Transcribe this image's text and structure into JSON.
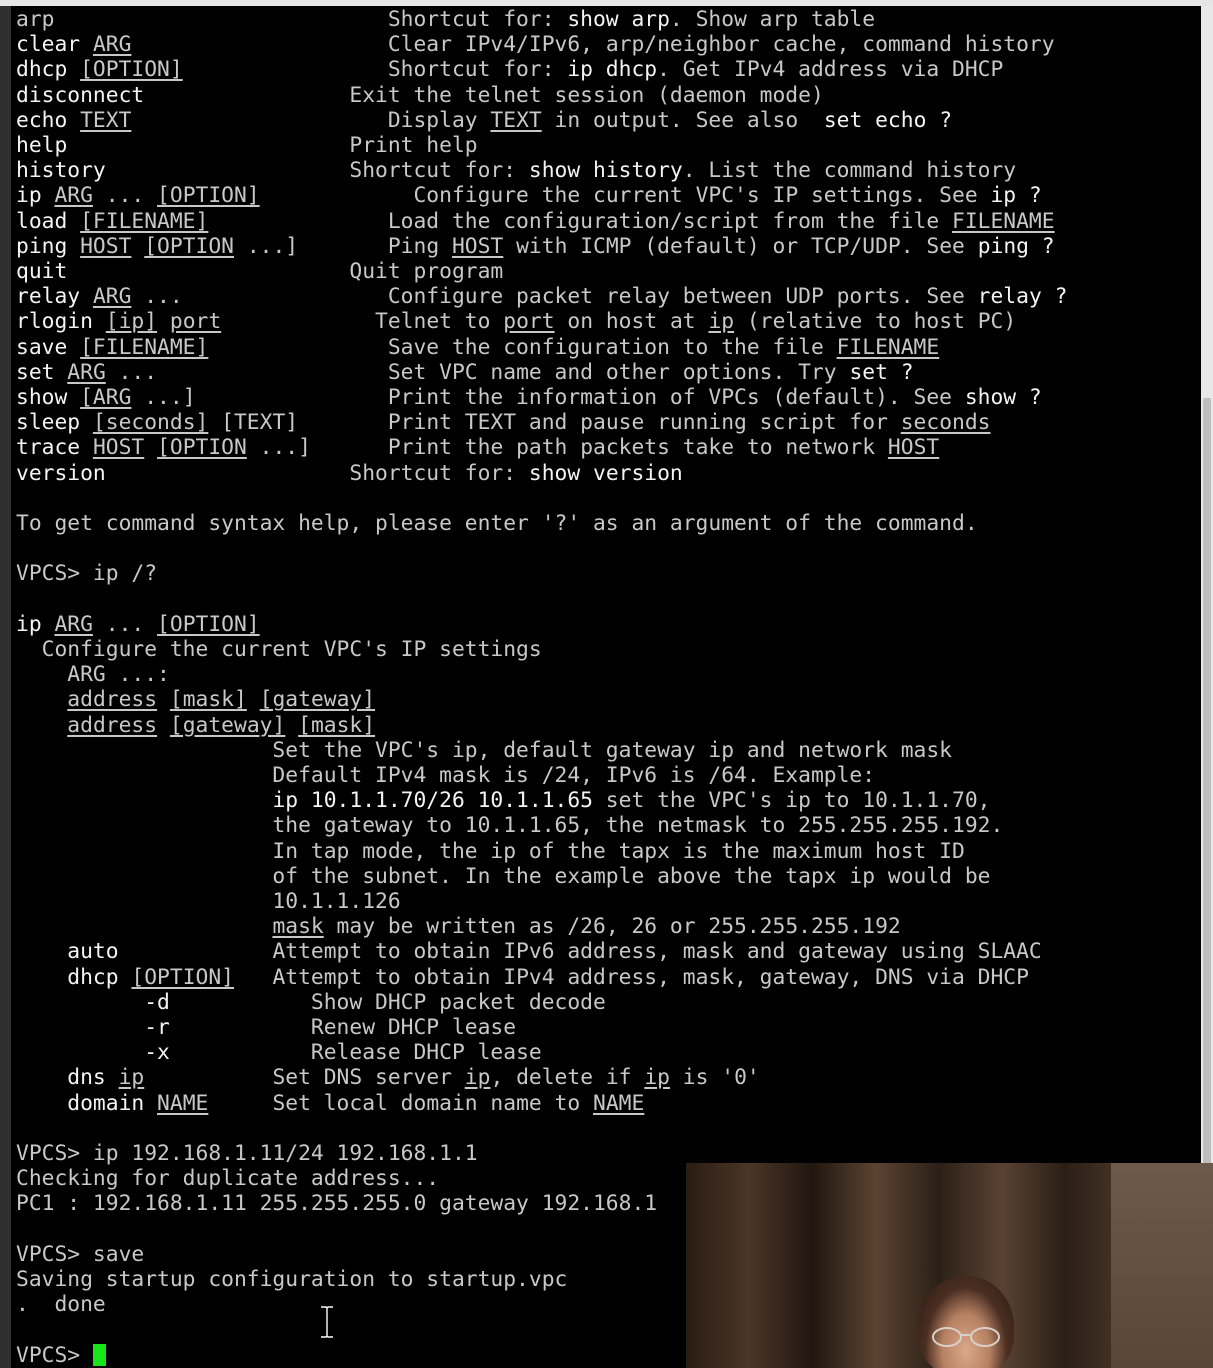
{
  "terminal": {
    "lines": [
      [
        {
          "t": "arp                          Shortcut for: "
        },
        {
          "t": "show arp",
          "c": "b"
        },
        {
          "t": ". Show arp table"
        }
      ],
      [
        {
          "t": "clear ",
          "c": "b"
        },
        {
          "t": "ARG",
          "c": "u"
        },
        {
          "t": "                    Clear IPv4/IPv6, arp/neighbor cache, command history"
        }
      ],
      [
        {
          "t": "dhcp ",
          "c": "b"
        },
        {
          "t": "[OPTION]",
          "c": "u"
        },
        {
          "t": "                Shortcut for: "
        },
        {
          "t": "ip dhcp",
          "c": "b"
        },
        {
          "t": ". Get IPv4 address via DHCP"
        }
      ],
      [
        {
          "t": "disconnect",
          "c": "b"
        },
        {
          "t": "                Exit the telnet session (daemon mode)"
        }
      ],
      [
        {
          "t": "echo ",
          "c": "b"
        },
        {
          "t": "TEXT",
          "c": "u"
        },
        {
          "t": "                    Display "
        },
        {
          "t": "TEXT",
          "c": "u"
        },
        {
          "t": " in output. See also  "
        },
        {
          "t": "set echo ?",
          "c": "b"
        }
      ],
      [
        {
          "t": "help",
          "c": "b"
        },
        {
          "t": "                      Print help"
        }
      ],
      [
        {
          "t": "history",
          "c": "b"
        },
        {
          "t": "                   Shortcut for: "
        },
        {
          "t": "show history",
          "c": "b"
        },
        {
          "t": ". List the command history"
        }
      ],
      [
        {
          "t": "ip ",
          "c": "b"
        },
        {
          "t": "ARG",
          "c": "u"
        },
        {
          "t": " ... "
        },
        {
          "t": "[OPTION]",
          "c": "u"
        },
        {
          "t": "            Configure the current VPC's IP settings. See "
        },
        {
          "t": "ip ?",
          "c": "b"
        }
      ],
      [
        {
          "t": "load ",
          "c": "b"
        },
        {
          "t": "[FILENAME]",
          "c": "u"
        },
        {
          "t": "              Load the configuration/script from the file "
        },
        {
          "t": "FILENAME",
          "c": "u"
        }
      ],
      [
        {
          "t": "ping ",
          "c": "b"
        },
        {
          "t": "HOST",
          "c": "u"
        },
        {
          "t": " "
        },
        {
          "t": "[OPTION",
          "c": "u"
        },
        {
          "t": " ...]       Ping "
        },
        {
          "t": "HOST",
          "c": "u"
        },
        {
          "t": " with ICMP (default) or TCP/UDP. See "
        },
        {
          "t": "ping ?",
          "c": "b"
        }
      ],
      [
        {
          "t": "quit",
          "c": "b"
        },
        {
          "t": "                      Quit program"
        }
      ],
      [
        {
          "t": "relay ",
          "c": "b"
        },
        {
          "t": "ARG",
          "c": "u"
        },
        {
          "t": " ...                Configure packet relay between UDP ports. See "
        },
        {
          "t": "relay ?",
          "c": "b"
        }
      ],
      [
        {
          "t": "rlogin ",
          "c": "b"
        },
        {
          "t": "[ip]",
          "c": "u"
        },
        {
          "t": " "
        },
        {
          "t": "port",
          "c": "u"
        },
        {
          "t": "            Telnet to "
        },
        {
          "t": "port",
          "c": "u"
        },
        {
          "t": " on host at "
        },
        {
          "t": "ip",
          "c": "u"
        },
        {
          "t": " (relative to host PC)"
        }
      ],
      [
        {
          "t": "save ",
          "c": "b"
        },
        {
          "t": "[FILENAME]",
          "c": "u"
        },
        {
          "t": "              Save the configuration to the file "
        },
        {
          "t": "FILENAME",
          "c": "u"
        }
      ],
      [
        {
          "t": "set ",
          "c": "b"
        },
        {
          "t": "ARG",
          "c": "u"
        },
        {
          "t": " ...                  Set VPC name and other options. Try "
        },
        {
          "t": "set ?",
          "c": "b"
        }
      ],
      [
        {
          "t": "show ",
          "c": "b"
        },
        {
          "t": "[ARG",
          "c": "u"
        },
        {
          "t": " ...]               Print the information of VPCs (default). See "
        },
        {
          "t": "show ?",
          "c": "b"
        }
      ],
      [
        {
          "t": "sleep ",
          "c": "b"
        },
        {
          "t": "[seconds]",
          "c": "u"
        },
        {
          "t": " [TEXT]       Print TEXT and pause running script for "
        },
        {
          "t": "seconds",
          "c": "u"
        }
      ],
      [
        {
          "t": "trace ",
          "c": "b"
        },
        {
          "t": "HOST",
          "c": "u"
        },
        {
          "t": " "
        },
        {
          "t": "[OPTION",
          "c": "u"
        },
        {
          "t": " ...]      Print the path packets take to network "
        },
        {
          "t": "HOST",
          "c": "u"
        }
      ],
      [
        {
          "t": "version",
          "c": "b"
        },
        {
          "t": "                   Shortcut for: "
        },
        {
          "t": "show version",
          "c": "b"
        }
      ],
      [
        {
          "t": ""
        }
      ],
      [
        {
          "t": "To get command syntax help, please enter '?' as an argument of the command."
        }
      ],
      [
        {
          "t": ""
        }
      ],
      [
        {
          "t": "VPCS> ip /?"
        }
      ],
      [
        {
          "t": ""
        }
      ],
      [
        {
          "t": "ip ",
          "c": "b"
        },
        {
          "t": "ARG",
          "c": "u"
        },
        {
          "t": " ... "
        },
        {
          "t": "[OPTION]",
          "c": "u"
        }
      ],
      [
        {
          "t": "  Configure the current VPC's IP settings"
        }
      ],
      [
        {
          "t": "    ARG ...:"
        }
      ],
      [
        {
          "t": "    "
        },
        {
          "t": "address",
          "c": "u"
        },
        {
          "t": " "
        },
        {
          "t": "[mask]",
          "c": "u"
        },
        {
          "t": " "
        },
        {
          "t": "[gateway]",
          "c": "u"
        }
      ],
      [
        {
          "t": "    "
        },
        {
          "t": "address",
          "c": "u"
        },
        {
          "t": " "
        },
        {
          "t": "[gateway]",
          "c": "u"
        },
        {
          "t": " "
        },
        {
          "t": "[mask]",
          "c": "u"
        }
      ],
      [
        {
          "t": "                    Set the VPC's ip, default gateway ip and network mask"
        }
      ],
      [
        {
          "t": "                    Default IPv4 mask is /24, IPv6 is /64. Example:"
        }
      ],
      [
        {
          "t": "                    "
        },
        {
          "t": "ip 10.1.1.70/26 10.1.1.65",
          "c": "b"
        },
        {
          "t": " set the VPC's ip to 10.1.1.70,"
        }
      ],
      [
        {
          "t": "                    the gateway to 10.1.1.65, the netmask to 255.255.255.192."
        }
      ],
      [
        {
          "t": "                    In tap mode, the ip of the tapx is the maximum host ID"
        }
      ],
      [
        {
          "t": "                    of the subnet. In the example above the tapx ip would be"
        }
      ],
      [
        {
          "t": "                    10.1.1.126"
        }
      ],
      [
        {
          "t": "                    "
        },
        {
          "t": "mask",
          "c": "u"
        },
        {
          "t": " may be written as /26, 26 or 255.255.255.192"
        }
      ],
      [
        {
          "t": "    auto",
          "c": "b"
        },
        {
          "t": "            Attempt to obtain IPv6 address, mask and gateway using SLAAC"
        }
      ],
      [
        {
          "t": "    dhcp ",
          "c": "b"
        },
        {
          "t": "[OPTION]",
          "c": "u"
        },
        {
          "t": "   Attempt to obtain IPv4 address, mask, gateway, DNS via DHCP"
        }
      ],
      [
        {
          "t": "          -d",
          "c": "b"
        },
        {
          "t": "           Show DHCP packet decode"
        }
      ],
      [
        {
          "t": "          -r",
          "c": "b"
        },
        {
          "t": "           Renew DHCP lease"
        }
      ],
      [
        {
          "t": "          -x",
          "c": "b"
        },
        {
          "t": "           Release DHCP lease"
        }
      ],
      [
        {
          "t": "    dns ",
          "c": "b"
        },
        {
          "t": "ip",
          "c": "u"
        },
        {
          "t": "          Set DNS server "
        },
        {
          "t": "ip",
          "c": "u"
        },
        {
          "t": ", delete if "
        },
        {
          "t": "ip",
          "c": "u"
        },
        {
          "t": " is '0'"
        }
      ],
      [
        {
          "t": "    domain ",
          "c": "b"
        },
        {
          "t": "NAME",
          "c": "u"
        },
        {
          "t": "     Set local domain name to "
        },
        {
          "t": "NAME",
          "c": "u"
        }
      ],
      [
        {
          "t": ""
        }
      ],
      [
        {
          "t": "VPCS> ip 192.168.1.11/24 192.168.1.1"
        }
      ],
      [
        {
          "t": "Checking for duplicate address..."
        }
      ],
      [
        {
          "t": "PC1 : 192.168.1.11 255.255.255.0 gateway 192.168.1"
        }
      ],
      [
        {
          "t": ""
        }
      ],
      [
        {
          "t": "VPCS> save"
        }
      ],
      [
        {
          "t": "Saving startup configuration to startup.vpc"
        }
      ],
      [
        {
          "t": ".  done"
        }
      ],
      [
        {
          "t": ""
        }
      ],
      [
        {
          "t": "VPCS> "
        }
      ]
    ],
    "colors": {
      "background": "#000000",
      "text": "#c8c8c8",
      "bold_text": "#f4f4f4",
      "cursor": "#17e41b"
    }
  },
  "overlays": {
    "webcam": "webcam-feed",
    "mouse_cursor": "text-ibeam-cursor-icon"
  }
}
